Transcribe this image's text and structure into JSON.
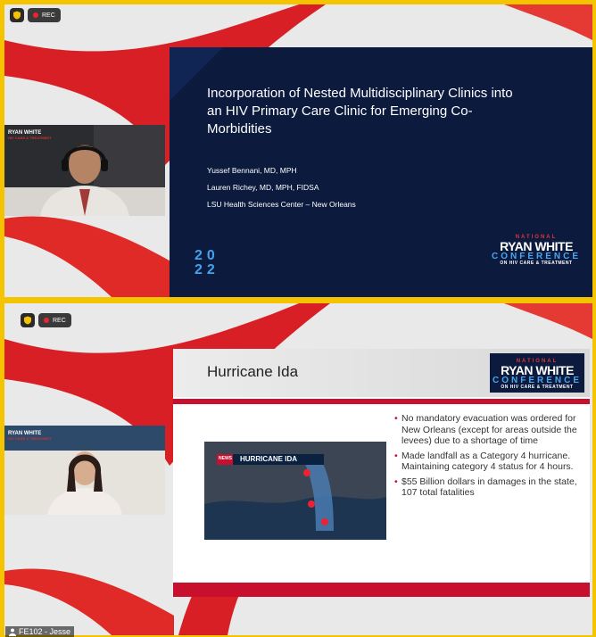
{
  "frame1": {
    "rec_label": "REC",
    "cam_logo_top": "RYAN WHITE",
    "cam_logo_sub": "HIV CARE & TREATMENT",
    "slide": {
      "title": "Incorporation of Nested Multidisciplinary Clinics into an HIV Primary Care Clinic for Emerging Co-Morbidities",
      "authors": [
        "Yussef Bennani, MD, MPH",
        "Lauren Richey, MD, MPH, FIDSA",
        "LSU Health Sciences Center – New Orleans"
      ],
      "year_top": "20",
      "year_bottom": "22",
      "brand": {
        "national": "NATIONAL",
        "ryan_white": "RYAN WHITE",
        "conference": "CONFERENCE",
        "hiv": "ON HIV CARE & TREATMENT"
      }
    }
  },
  "frame2": {
    "rec_label": "REC",
    "cam_logo_top": "RYAN WHITE",
    "cam_logo_sub": "HIV CARE & TREATMENT",
    "slide": {
      "title": "Hurricane Ida",
      "brand": {
        "national": "NATIONAL",
        "ryan_white": "RYAN WHITE",
        "conference": "CONFERENCE",
        "hiv": "ON HIV CARE & TREATMENT"
      },
      "map_caption": "HURRICANE IDA",
      "map_news": "NEWS",
      "bullets": [
        "No mandatory evacuation was ordered for New Orleans (except for areas outside the levees) due to a shortage of time",
        "Made landfall as a Category 4 hurricane.  Maintaining category 4 status for 4 hours.",
        "$55 Billion dollars in damages in the state, 107 total fatalities"
      ]
    }
  },
  "participant_name": "FE102 - Jesse",
  "colors": {
    "border": "#f5c400",
    "slide_navy": "#0b1a3d",
    "accent_red": "#c8102e",
    "accent_blue": "#4aa6ee"
  },
  "icons": {
    "shield": "shield-icon",
    "rec": "record-dot-icon",
    "user": "user-icon"
  }
}
